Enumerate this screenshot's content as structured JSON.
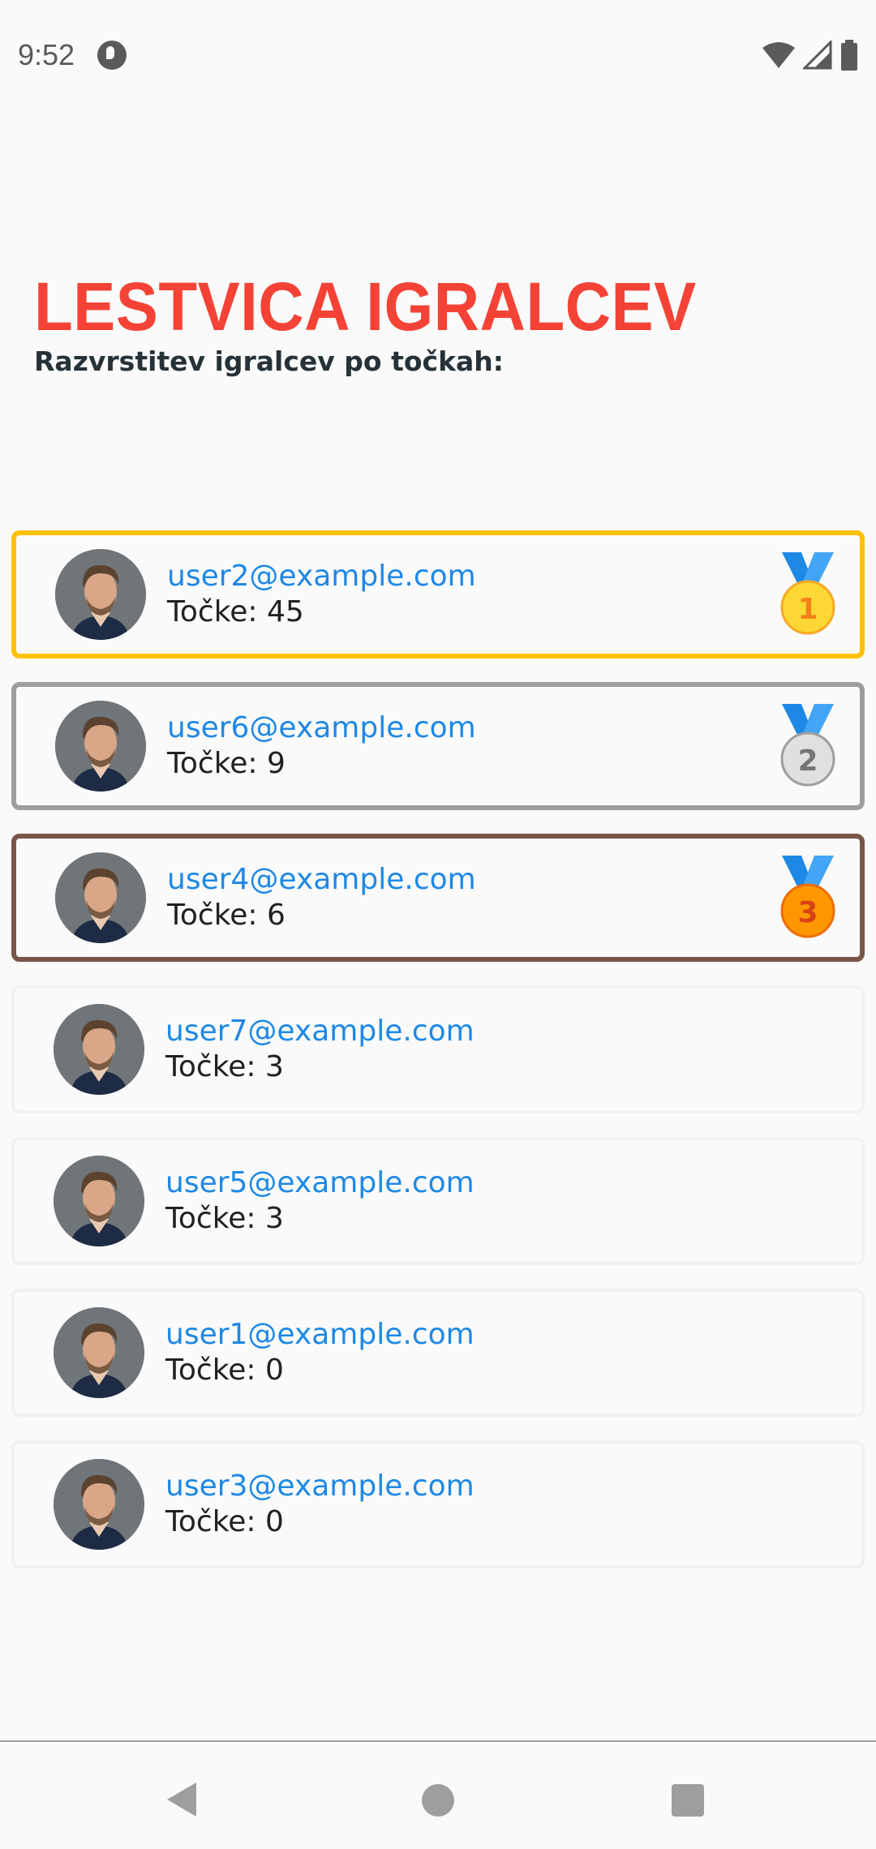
{
  "status_bar": {
    "time": "9:52"
  },
  "header": {
    "title": "LESTVICA IGRALCEV",
    "subtitle": "Razvrstitev igralcev po točkah:"
  },
  "leaderboard": [
    {
      "email": "user2@example.com",
      "points": "Točke: 45",
      "medal": "1"
    },
    {
      "email": "user6@example.com",
      "points": "Točke: 9",
      "medal": "2"
    },
    {
      "email": "user4@example.com",
      "points": "Točke: 6",
      "medal": "3"
    },
    {
      "email": "user7@example.com",
      "points": "Točke: 3"
    },
    {
      "email": "user5@example.com",
      "points": "Točke: 3"
    },
    {
      "email": "user1@example.com",
      "points": "Točke: 0"
    },
    {
      "email": "user3@example.com",
      "points": "Točke: 0"
    }
  ],
  "colors": {
    "title": "#f44336",
    "email": "#1e88e5",
    "gold_border": "#ffc107",
    "silver_border": "#9e9e9e",
    "bronze_border": "#795548"
  }
}
